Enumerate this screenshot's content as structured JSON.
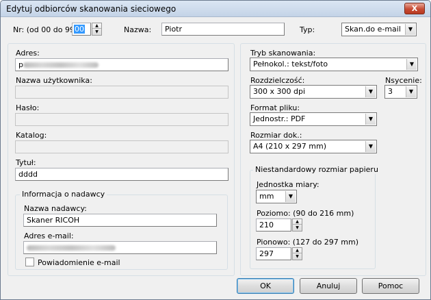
{
  "window": {
    "title": "Edytuj odbiorców skanowania sieciowego",
    "close_label": "X"
  },
  "top": {
    "nr_label": "Nr: (od 00 do 99",
    "nr_value": "00",
    "name_label": "Nazwa:",
    "name_value": "Piotr",
    "type_label": "Typ:",
    "type_value": "Skan.do e-mail"
  },
  "left": {
    "address_label": "Adres:",
    "address_value": "p",
    "username_label": "Nazwa użytkownika:",
    "username_value": "",
    "password_label": "Hasło:",
    "password_value": "",
    "folder_label": "Katalog:",
    "folder_value": "",
    "subject_label": "Tytuł:",
    "subject_value": "dddd"
  },
  "sender": {
    "group_title": "Informacja o nadawcy",
    "name_label": "Nazwa nadawcy:",
    "name_value": "Skaner RICOH",
    "email_label": "Adres e-mail:",
    "email_value": "",
    "notify_label": "Powiadomienie e-mail",
    "notify_checked": false
  },
  "right": {
    "scan_mode_label": "Tryb skanowania:",
    "scan_mode_value": "Pełnokol.: tekst/foto",
    "resolution_label": "Rozdzielczość:",
    "resolution_value": "300 x 300 dpi",
    "density_label": "Nsycenie:",
    "density_value": "3",
    "file_format_label": "Format pliku:",
    "file_format_value": "Jednostr.: PDF",
    "doc_size_label": "Rozmiar dok.:",
    "doc_size_value": "A4 (210 x 297 mm)"
  },
  "custom_size": {
    "group_title": "Niestandardowy rozmiar papieru",
    "unit_label": "Jednostka miary:",
    "unit_value": "mm",
    "horizontal_label": "Poziomo: (90 do 216 mm)",
    "horizontal_value": "210",
    "vertical_label": "Pionowo: (127 do 297 mm)",
    "vertical_value": "297"
  },
  "buttons": {
    "ok": "OK",
    "cancel": "Anuluj",
    "help": "Pomoc"
  }
}
